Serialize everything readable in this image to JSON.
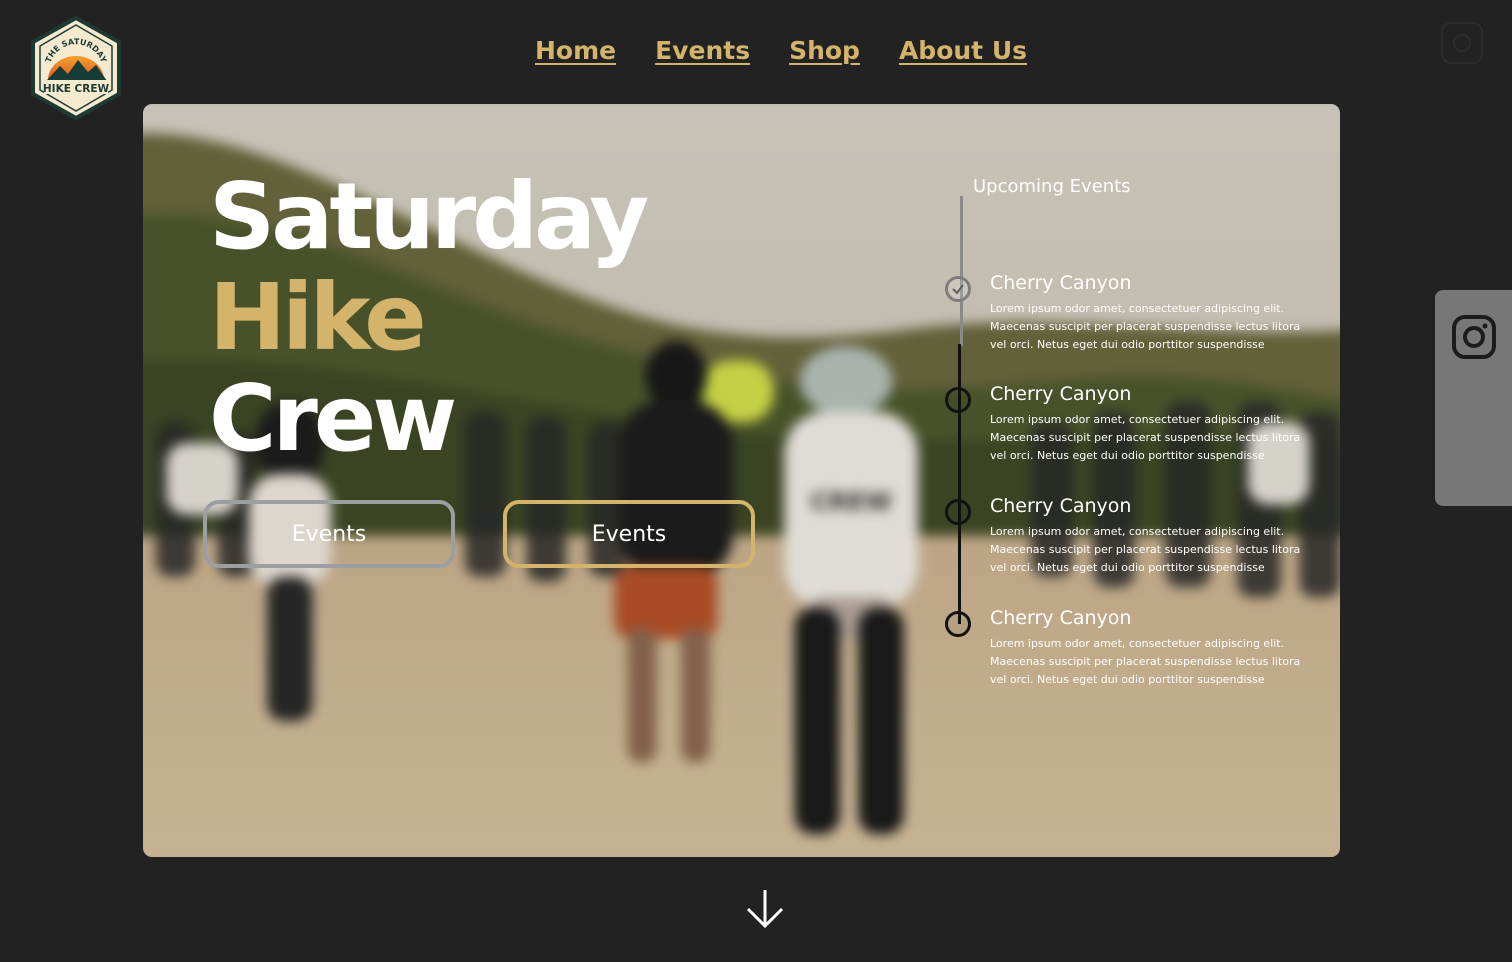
{
  "logo": {
    "top_text": "THE SATURDAY",
    "bottom_text": "HIKE CREW"
  },
  "nav": {
    "items": [
      {
        "label": "Home"
      },
      {
        "label": "Events"
      },
      {
        "label": "Shop"
      },
      {
        "label": "About Us"
      }
    ]
  },
  "hero": {
    "title": {
      "line1": "Saturday",
      "line2": "Hike",
      "line3": "Crew"
    },
    "buttons": [
      {
        "label": "Events"
      },
      {
        "label": "Events"
      }
    ],
    "shirt_text": "CREW"
  },
  "timeline": {
    "heading": "Upcoming Events",
    "items": [
      {
        "title": "Cherry Canyon",
        "description": "Lorem ipsum odor amet, consectetuer adipiscing elit. Maecenas suscipit per placerat suspendisse lectus litora vel orci. Netus eget dui odio porttitor suspendisse",
        "completed": true
      },
      {
        "title": "Cherry Canyon",
        "description": "Lorem ipsum odor amet, consectetuer adipiscing elit. Maecenas suscipit per placerat suspendisse lectus litora vel orci. Netus eget dui odio porttitor suspendisse",
        "completed": false
      },
      {
        "title": "Cherry Canyon",
        "description": "Lorem ipsum odor amet, consectetuer adipiscing elit. Maecenas suscipit per placerat suspendisse lectus litora vel orci. Netus eget dui odio porttitor suspendisse",
        "completed": false
      },
      {
        "title": "Cherry Canyon",
        "description": "Lorem ipsum odor amet, consectetuer adipiscing elit. Maecenas suscipit per placerat suspendisse lectus litora vel orci. Netus eget dui odio porttitor suspendisse",
        "completed": false
      }
    ]
  },
  "icons": {
    "corner": "instagram-icon",
    "side_tab": "instagram-icon",
    "scroll": "arrow-down-icon",
    "timeline_done": "check-icon"
  },
  "colors": {
    "background": "#222222",
    "accent": "#d4b36a",
    "button_gray": "#9c9fa1",
    "side_tab": "#777777"
  }
}
